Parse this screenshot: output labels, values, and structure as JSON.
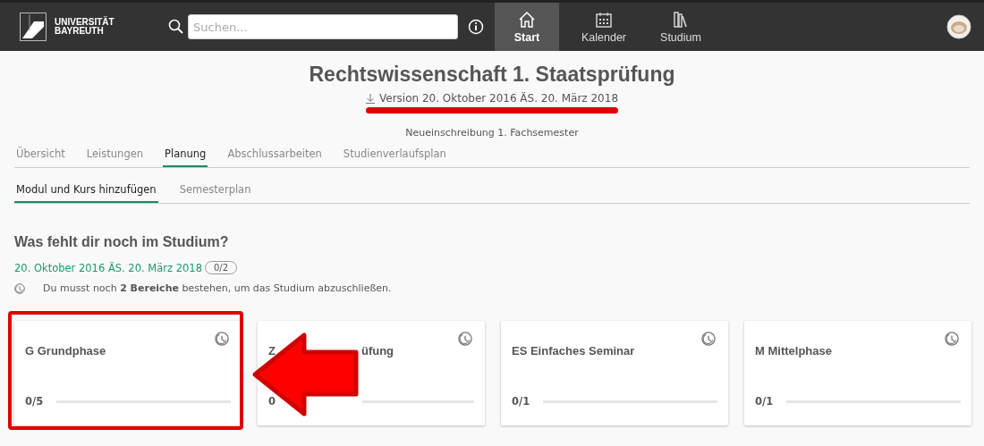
{
  "header": {
    "logo": [
      "UNIVERSITÄT",
      "BAYREUTH"
    ],
    "search": {
      "placeholder": "Suchen..."
    },
    "nav": [
      {
        "label": "Start",
        "selected": true
      },
      {
        "label": "Kalender",
        "selected": false
      },
      {
        "label": "Studium",
        "selected": false
      }
    ]
  },
  "title": "Rechtswissenschaft 1. Staatsprüfung",
  "version": "Version 20. Oktober 2016 ÄS. 20. März 2018",
  "subtitle": "Neueinschreibung 1. Fachsemester",
  "tabs": [
    {
      "label": "Übersicht",
      "selected": false
    },
    {
      "label": "Leistungen",
      "selected": false
    },
    {
      "label": "Planung",
      "selected": true
    },
    {
      "label": "Abschlussarbeiten",
      "selected": false
    },
    {
      "label": "Studienverlaufsplan",
      "selected": false
    }
  ],
  "subtabs": [
    {
      "label": "Modul und Kurs hinzufügen",
      "selected": true
    },
    {
      "label": "Semesterplan",
      "selected": false
    }
  ],
  "section": {
    "heading": "Was fehlt dir noch im Studium?",
    "date": "20. Oktober 2016 ÄS. 20. März 2018",
    "badge": "0/2",
    "info": "Du musst noch **2 Bereiche** bestehen, um das Studium abzuschließen."
  },
  "cards": [
    {
      "kind": "highlighted",
      "title_parts": [
        "G Grundphase"
      ],
      "count": "0/5"
    },
    {
      "kind": "covered",
      "title_parts": [
        "Z",
        "üfung"
      ],
      "count": "0"
    },
    {
      "kind": "plain",
      "title_parts": [
        "ES Einfaches Seminar"
      ],
      "count": "0/1"
    },
    {
      "kind": "plain",
      "title_parts": [
        "M Mittelphase"
      ],
      "count": "0/1"
    }
  ]
}
